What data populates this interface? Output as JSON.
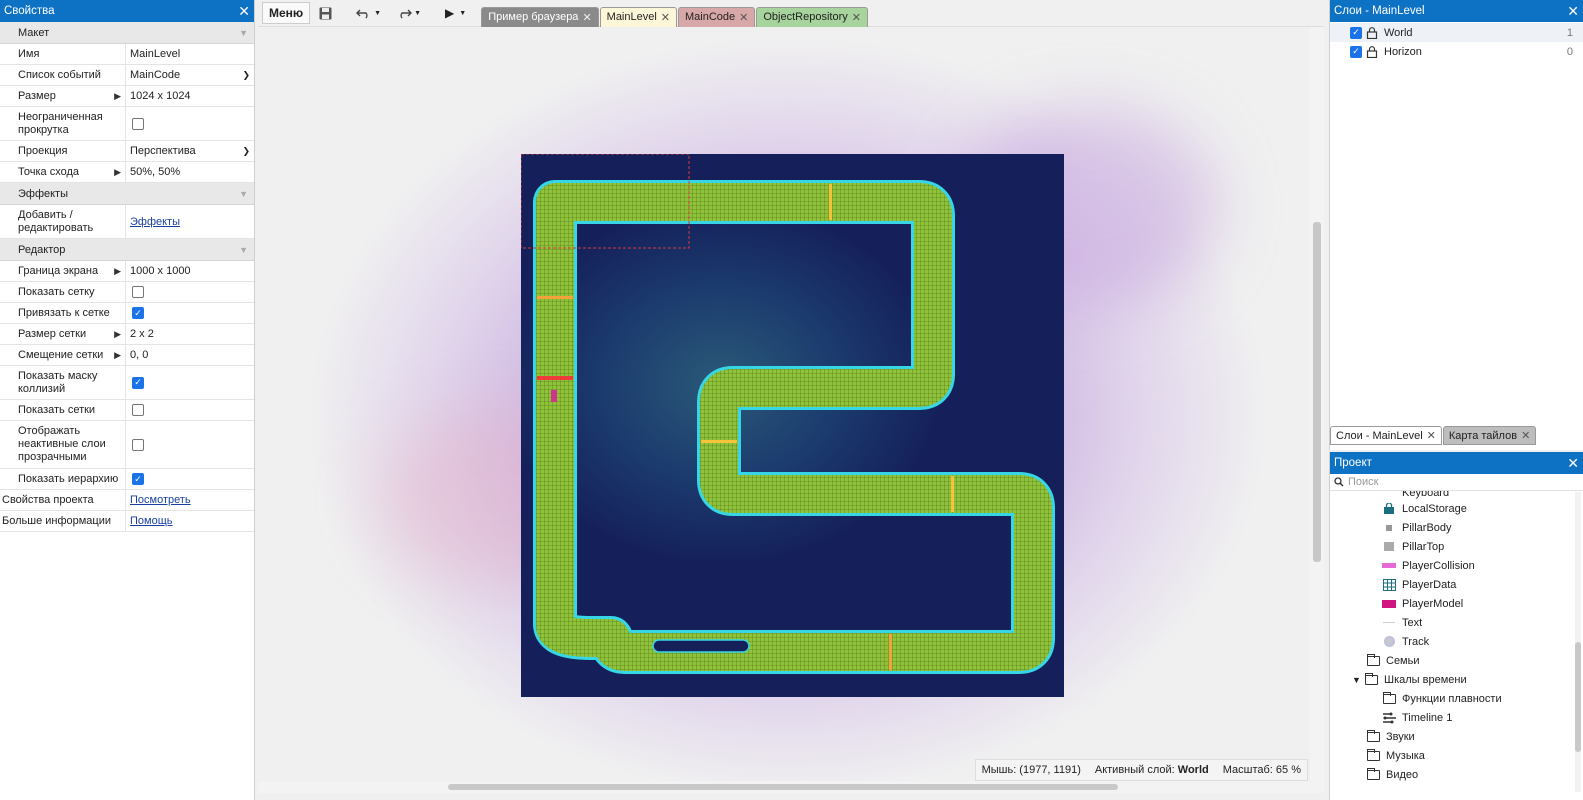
{
  "properties": {
    "title": "Свойства",
    "close": "✕",
    "sections": {
      "layout": "Макет",
      "effects": "Эффекты",
      "editor": "Редактор"
    },
    "layout_rows": {
      "name_label": "Имя",
      "name_value": "MainLevel",
      "events_label": "Список событий",
      "events_value": "MainCode",
      "size_label": "Размер",
      "size_value": "1024 x 1024",
      "unbounded_label": "Неограниченная прокрутка",
      "projection_label": "Проекция",
      "projection_value": "Перспектива",
      "vanish_label": "Точка схода",
      "vanish_value": "50%,  50%"
    },
    "effects_rows": {
      "add_label": "Добавить / редактировать",
      "add_value": "Эффекты"
    },
    "editor_rows": {
      "screen_label": "Граница экрана",
      "screen_value": "1000 x 1000",
      "show_grid_label": "Показать сетку",
      "snap_label": "Привязать к сетке",
      "grid_size_label": "Размер сетки",
      "grid_size_value": "2 x 2",
      "grid_offset_label": "Смещение сетки",
      "grid_offset_value": "0,  0",
      "collision_label": "Показать маску коллизий",
      "mesh_label": "Показать сетки",
      "inactive_label": "Отображать неактивные слои прозрачными",
      "hierarchy_label": "Показать иерархию"
    },
    "footer": {
      "project_props_label": "Свойства проекта",
      "project_props_value": "Посмотреть",
      "more_info_label": "Больше информации",
      "more_info_value": "Помощь"
    }
  },
  "toolbar": {
    "menu": "Меню",
    "tabs": [
      "Пример браузера",
      "MainLevel",
      "MainCode",
      "ObjectRepository"
    ],
    "tab_colors": [
      "#8a8a8a",
      "#fdf6d8",
      "#d8a7a7",
      "#a7d39c"
    ]
  },
  "status": {
    "mouse": "Мышь: (1977, 1191)",
    "active_layer_label": "Активный слой:",
    "active_layer_value": "World",
    "zoom": "Масштаб: 65 %"
  },
  "layers": {
    "title": "Слои - MainLevel",
    "items": [
      {
        "name": "World",
        "num": "1"
      },
      {
        "name": "Horizon",
        "num": "0"
      }
    ],
    "bottom_tabs": [
      "Слои - MainLevel",
      "Карта тайлов"
    ]
  },
  "project": {
    "title": "Проект",
    "search_placeholder": "Поиск",
    "items": [
      "Keyboard",
      "LocalStorage",
      "PillarBody",
      "PillarTop",
      "PlayerCollision",
      "PlayerData",
      "PlayerModel",
      "Text",
      "Track"
    ],
    "folders": [
      "Семьи",
      "Шкалы времени",
      "Функции плавности",
      "Timeline 1",
      "Звуки",
      "Музыка",
      "Видео"
    ]
  },
  "colors": {
    "accent": "#0e72c4",
    "track_green": "#8fc43a",
    "track_outline": "#36d6e6",
    "level_bg": "#15205a"
  }
}
